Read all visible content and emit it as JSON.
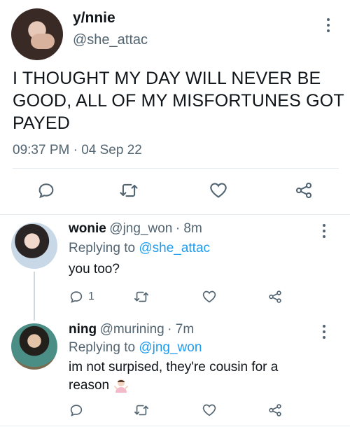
{
  "tweet": {
    "display_name": "y/nnie",
    "handle": "@she_attac",
    "text_line1": "I THOUGHT MY DAY WILL NEVER BE",
    "text_line2": "GOOD, ALL OF MY MISFORTUNES GOT",
    "text_line3": "PAYED",
    "timestamp": "09:37 PM · 04 Sep 22"
  },
  "replies": [
    {
      "display_name": "wonie",
      "handle": "@jng_won",
      "time": "· 8m",
      "replying_label": "Replying to",
      "replying_to": "@she_attac",
      "text_line1": "you too?",
      "text_line2": "",
      "reply_count": "1"
    },
    {
      "display_name": "ning",
      "handle": "@murining",
      "time": "· 7m",
      "replying_label": "Replying to",
      "replying_to": "@jng_won",
      "text_line1": "im not surpised, they're cousin for a",
      "text_line2": "reason",
      "reply_count": ""
    }
  ],
  "icons": {
    "reply": "reply-icon",
    "retweet": "retweet-icon",
    "like": "like-icon",
    "share": "share-icon",
    "more": "more-options-icon"
  },
  "colors": {
    "link": "#1d9bf0",
    "muted": "#536471",
    "text": "#0f1419"
  }
}
